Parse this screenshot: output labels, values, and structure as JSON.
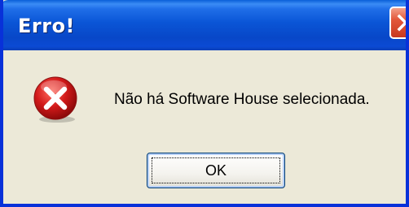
{
  "window": {
    "title": "Erro!",
    "close_icon": "close-icon"
  },
  "dialog": {
    "icon": "error-icon",
    "message": "Não há Software House selecionada.",
    "ok_label": "OK"
  },
  "colors": {
    "titlebar": "#0a55d6",
    "frame": "#0831d9",
    "body": "#ece9d8",
    "close": "#e2573a",
    "error_red": "#d21a1a"
  }
}
